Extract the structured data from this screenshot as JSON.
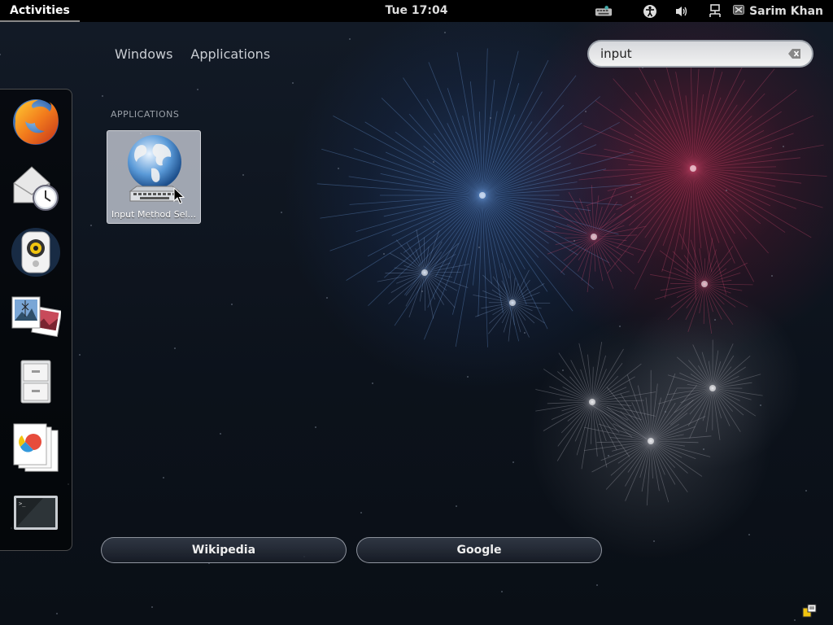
{
  "top_panel": {
    "activities": "Activities",
    "clock": "Tue 17:04",
    "user_name": "Sarim Khan",
    "tray_icons": [
      "keyboard-icon",
      "accessibility-icon",
      "volume-icon",
      "network-icon",
      "user-status-icon"
    ]
  },
  "view_selector": {
    "tabs": [
      {
        "label": "Windows"
      },
      {
        "label": "Applications"
      }
    ]
  },
  "search": {
    "value": "input",
    "placeholder": "",
    "clear_icon": "clear-search-icon"
  },
  "dash": {
    "items": [
      {
        "name": "firefox-icon"
      },
      {
        "name": "evolution-mail-icon"
      },
      {
        "name": "rhythmbox-icon"
      },
      {
        "name": "shotwell-photos-icon"
      },
      {
        "name": "file-cabinet-icon"
      },
      {
        "name": "office-documents-icon"
      },
      {
        "name": "terminal-icon"
      }
    ]
  },
  "results": {
    "heading": "APPLICATIONS",
    "items": [
      {
        "label": "Input Method Sel...",
        "icon": "globe-keyboard-icon"
      }
    ]
  },
  "search_providers": [
    {
      "label": "Wikipedia"
    },
    {
      "label": "Google"
    }
  ],
  "colors": {
    "panel": "#000000",
    "background": "#0c121b",
    "firework_red": "#a01e3c",
    "firework_blue": "#325aa0"
  }
}
